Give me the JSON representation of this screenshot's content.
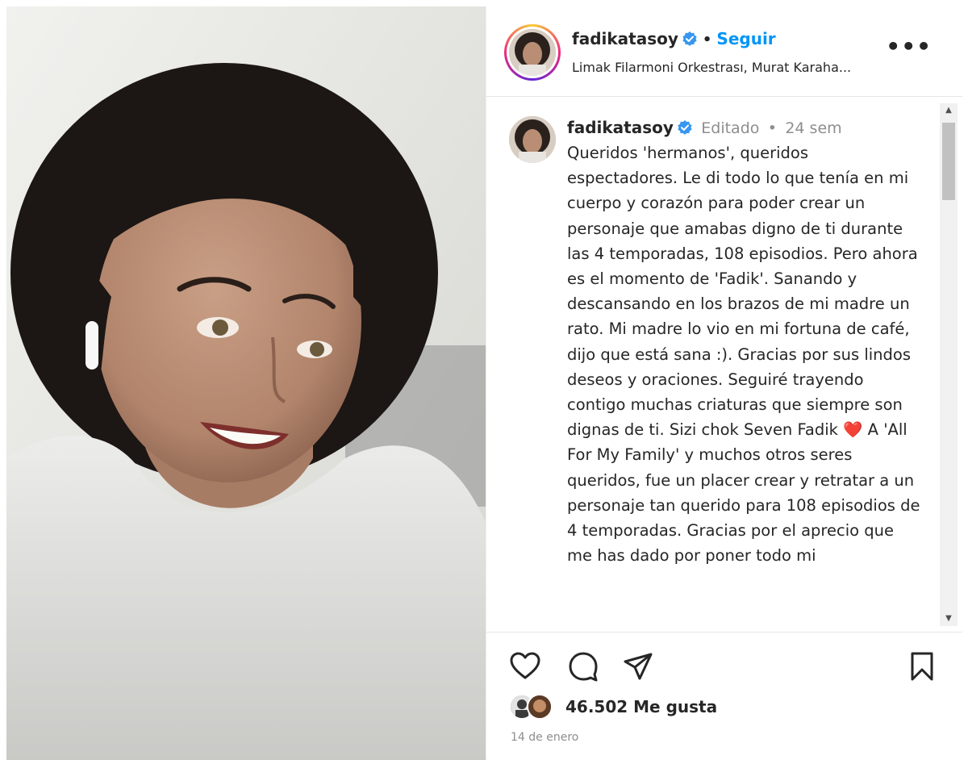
{
  "header": {
    "username": "fadikatasoy",
    "follow_label": "Seguir",
    "separator": "•",
    "audio": "Limak Filarmoni Orkestrası, Murat Karaha...",
    "more_label": "•••"
  },
  "caption": {
    "username": "fadikatasoy",
    "edited_label": "Editado",
    "separator": "•",
    "time_ago": "24 sem",
    "text_part1": "Queridos 'hermanos', queridos espectadores. Le di todo lo que tenía en mi cuerpo y corazón para poder crear un personaje que amabas digno de ti durante las 4 temporadas, 108 episodios. Pero ahora es el momento de 'Fadik'. Sanando y descansando en los brazos de mi madre un rato. Mi madre lo vio en mi fortuna de café, dijo que está sana :). Gracias por sus lindos deseos y oraciones. Seguiré trayendo contigo muchas criaturas que siempre son dignas de ti. Sizi chok Seven Fadik",
    "emoji": "❤️",
    "text_part2": " A 'All For My Family' y muchos otros seres queridos, fue un placer crear y retratar a un personaje tan querido para 108 episodios de 4 temporadas. Gracias por el aprecio que me has dado por poner todo mi"
  },
  "actions": {
    "like_icon": "heart-icon",
    "comment_icon": "comment-icon",
    "share_icon": "send-icon",
    "save_icon": "bookmark-icon"
  },
  "likes": {
    "text": "46.502 Me gusta"
  },
  "date": "14 de enero",
  "colors": {
    "follow_blue": "#0095f6",
    "verified_blue": "#3897f0",
    "text": "#262626",
    "muted": "#8e8e8e"
  }
}
